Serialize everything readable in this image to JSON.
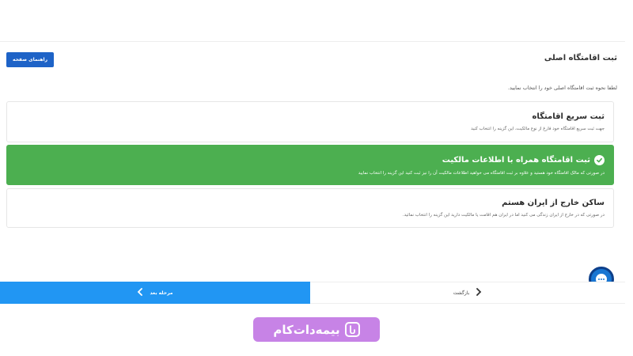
{
  "header": {
    "help_button_label": "راهنمای صفحه",
    "title": "ثبت اقامتگاه اصلی",
    "instruction": "لطفا نحوه ثبت اقامتگاه اصلی خود را انتخاب نمایید."
  },
  "options": [
    {
      "title": "ثبت سریع اقامتگاه",
      "description": "جهت ثبت سریع اقامتگاه خود فارغ از نوع مالکیت، این گزینه را انتخاب کنید",
      "selected": false
    },
    {
      "title": "ثبت اقامتگاه همراه با اطلاعات مالکیت",
      "description": "در صورتی که مالک اقامتگاه خود هستید و علاوه بر ثبت اقامتگاه می خواهید اطلاعات مالکیت آن را نیز ثبت کنید این گزینه را انتخاب نمایید",
      "selected": true
    },
    {
      "title": "ساکن خارج از ایران هستم",
      "description": "در صورتی که در خارج از ایران زندگی می کنید اما در ایران هم اقامت یا مالکیت دارید این گزینه را انتخاب نمائید.",
      "selected": false
    }
  ],
  "footer": {
    "next_label": "مرحله بعد",
    "back_label": "بازگشت"
  },
  "watermark": {
    "text": "بیمه‌دات‌کام"
  },
  "colors": {
    "accent_blue": "#2196f3",
    "selected_green": "#4caf50",
    "help_button": "#1e63c7",
    "watermark": "#c783e6"
  }
}
